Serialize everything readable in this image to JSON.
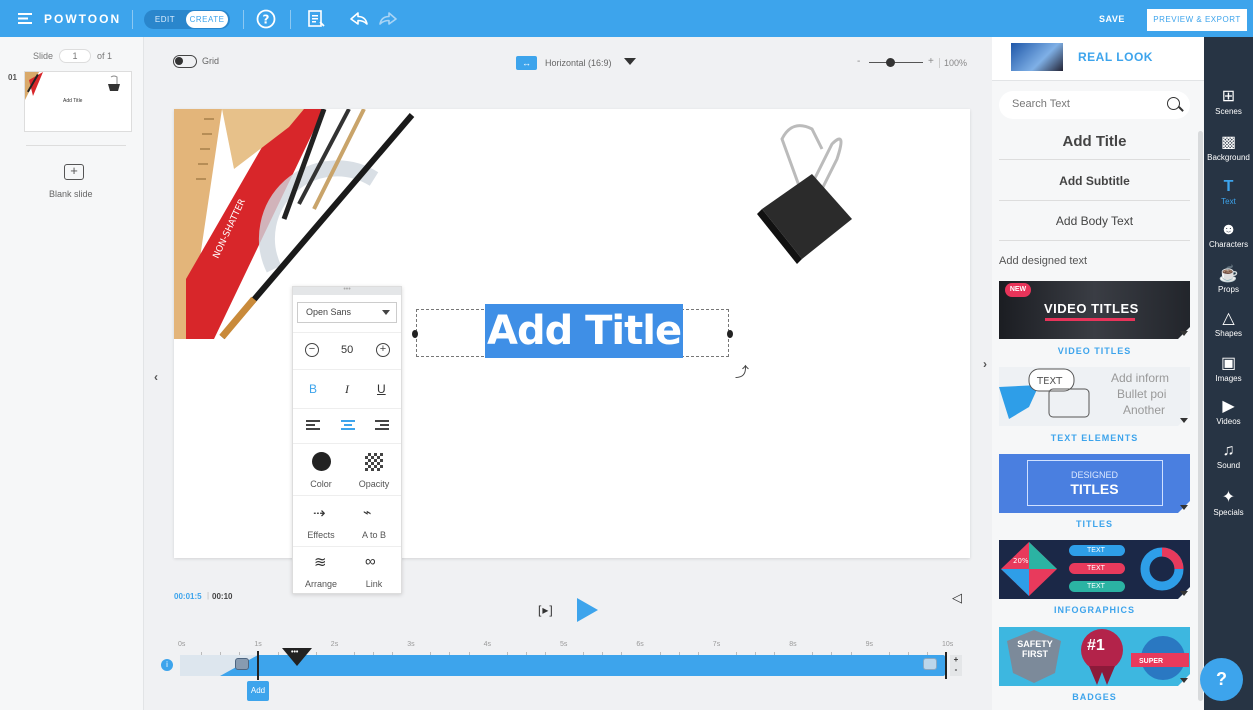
{
  "topbar": {
    "logo": "POWTOON",
    "mode_edit": "EDIT",
    "mode_create": "CREATE",
    "save": "SAVE",
    "preview_export": "PREVIEW & EXPORT"
  },
  "left_panel": {
    "slide_label": "Slide",
    "slide_number": "1",
    "slide_of": "of 1",
    "thumb_index": "01",
    "thumb_title": "Add Title",
    "blank_slide": "Blank slide"
  },
  "canvas_toolbar": {
    "grid_label": "Grid",
    "aspect_label": "Horizontal (16:9)",
    "zoom_minus": "-",
    "zoom_plus": "+",
    "zoom_value": "100%"
  },
  "slide": {
    "title_text": "Add Title"
  },
  "format_panel": {
    "font": "Open Sans",
    "size": "50",
    "bold": "B",
    "italic": "I",
    "underline": "U",
    "color": "Color",
    "opacity": "Opacity",
    "effects": "Effects",
    "a_to_b": "A to B",
    "arrange": "Arrange",
    "link": "Link"
  },
  "timeline": {
    "current_time": "00:01:5",
    "total_time": "00:10",
    "play_label": "[▸]",
    "ruler": [
      "0s",
      "1s",
      "2s",
      "3s",
      "4s",
      "5s",
      "6s",
      "7s",
      "8s",
      "9s",
      "10s"
    ],
    "add_label": "Add",
    "zoom_in": "+",
    "zoom_out": "-",
    "info": "i"
  },
  "right_panel": {
    "library_name": "REAL LOOK",
    "search_placeholder": "Search Text",
    "add_title": "Add Title",
    "add_subtitle": "Add Subtitle",
    "add_body": "Add Body Text",
    "designed_label": "Add designed text",
    "tiles": [
      {
        "caption": "VIDEO TITLES",
        "art_text": "VIDEO TITLES",
        "badge": "NEW"
      },
      {
        "caption": "TEXT ELEMENTS",
        "art_text": "TEXT",
        "art_lines": [
          "Add inform",
          "Bullet poi",
          "Another"
        ]
      },
      {
        "caption": "TITLES",
        "art_top": "DESIGNED",
        "art_main": "TITLES"
      },
      {
        "caption": "INFOGRAPHICS",
        "art_pct": "20%",
        "art_rows": [
          "TEXT",
          "TEXT",
          "TEXT"
        ]
      },
      {
        "caption": "BADGES",
        "art_a": "SAFETY FIRST",
        "art_b": "#1",
        "art_c": "SUPER"
      }
    ]
  },
  "rail": [
    {
      "label": "Scenes",
      "icon": "scenes-icon"
    },
    {
      "label": "Background",
      "icon": "background-icon"
    },
    {
      "label": "Text",
      "icon": "text-icon"
    },
    {
      "label": "Characters",
      "icon": "characters-icon"
    },
    {
      "label": "Props",
      "icon": "props-icon"
    },
    {
      "label": "Shapes",
      "icon": "shapes-icon"
    },
    {
      "label": "Images",
      "icon": "images-icon"
    },
    {
      "label": "Videos",
      "icon": "videos-icon"
    },
    {
      "label": "Sound",
      "icon": "sound-icon"
    },
    {
      "label": "Specials",
      "icon": "specials-icon"
    }
  ],
  "help": "?",
  "colors": {
    "accent": "#3da4ec",
    "rail": "#273444"
  }
}
